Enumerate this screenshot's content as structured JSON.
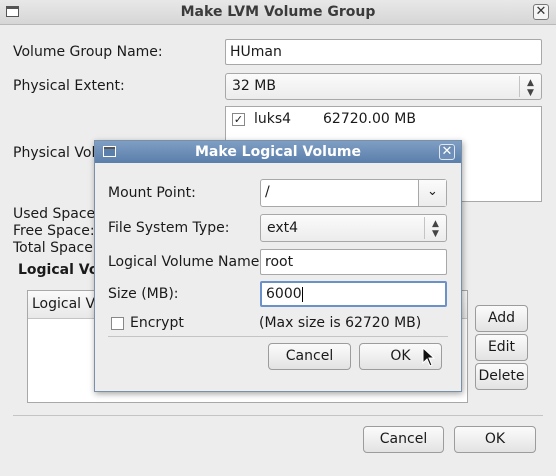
{
  "main_window": {
    "title": "Make LVM Volume Group",
    "vg_name_label": "Volume Group Name:",
    "vg_name_value": "HUman",
    "physical_extent_label": "Physical Extent:",
    "physical_extent_value": "32 MB",
    "physical_volumes_label": "Physical Volu",
    "physical_volumes": [
      {
        "checked": true,
        "name": "luks4",
        "size": "62720.00 MB"
      }
    ],
    "used_space_label": "Used Space:",
    "free_space_label": "Free Space:",
    "total_space_label": "Total Space:",
    "logical_volumes_heading": "Logical Vo",
    "lv_column_header": "Logical Vo",
    "add_label": "Add",
    "edit_label": "Edit",
    "delete_label": "Delete",
    "cancel_label": "Cancel",
    "ok_label": "OK"
  },
  "dialog": {
    "title": "Make Logical Volume",
    "mount_point_label": "Mount Point:",
    "mount_point_value": "/",
    "fs_type_label": "File System Type:",
    "fs_type_value": "ext4",
    "lv_name_label": "Logical Volume Name:",
    "lv_name_value": "root",
    "size_label": "Size (MB):",
    "size_value": "6000",
    "encrypt_label": "Encrypt",
    "encrypt_checked": false,
    "max_size_text": "(Max size is 62720 MB)",
    "cancel_label": "Cancel",
    "ok_label": "OK"
  }
}
